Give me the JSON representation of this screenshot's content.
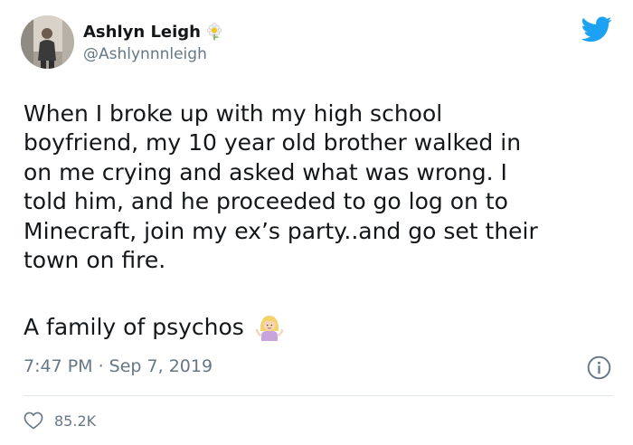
{
  "author": {
    "display_name": "Ashlyn Leigh",
    "handle": "@Ashlynnnleigh",
    "name_emoji": "flower-icon"
  },
  "tweet": {
    "text": "When I broke up with my high school\nboyfriend, my 10 year old brother walked in\non me crying and asked what was wrong. I\ntold him, and he proceeded to go log on to\nMinecraft, join my ex’s party..and go set their\ntown on fire.",
    "tagline": "A family of psychos",
    "tagline_emoji": "woman-shrugging-icon",
    "timestamp": "7:47 PM · Sep 7, 2019"
  },
  "stats": {
    "likes": "85.2K"
  },
  "icons": {
    "brand": "twitter-bird-icon",
    "info": "info-icon",
    "like": "heart-icon"
  },
  "colors": {
    "brand_blue": "#1da1f2",
    "text": "#14171a",
    "muted": "#657786",
    "divider": "#e1e8ed"
  }
}
